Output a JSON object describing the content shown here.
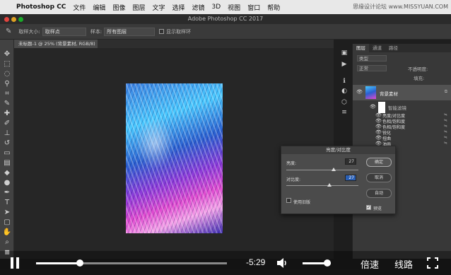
{
  "menubar": {
    "apple_glyph": "",
    "items": [
      "Photoshop CC",
      "文件",
      "编辑",
      "图像",
      "图层",
      "文字",
      "选择",
      "滤镜",
      "3D",
      "视图",
      "窗口",
      "帮助"
    ],
    "watermark": "思缘设计论坛 www.MISSYUAN.COM"
  },
  "window": {
    "title": "Adobe Photoshop CC 2017"
  },
  "options_bar": {
    "sample_size_label": "取样大小:",
    "sample_size_value": "取样点",
    "sample_label": "样本:",
    "sample_value": "所有图层",
    "show_ring_label": "显示取样环"
  },
  "document": {
    "tab_title": "未标题-1 @ 25% (背景素材, RGB/8) *"
  },
  "panel": {
    "tabs": [
      "图层",
      "通道",
      "路径"
    ],
    "filter_kind": "类型",
    "blend_mode": "正常",
    "opacity_label": "不透明度:",
    "fill_label": "填充:",
    "layer_name": "背景素材",
    "smart_filters_label": "智能滤镜",
    "filters": [
      "亮度/对比度",
      "色相/饱和度",
      "色相/饱和度",
      "锐化",
      "扭曲",
      "油画"
    ]
  },
  "dialog": {
    "title": "亮度/对比度",
    "brightness_label": "亮度:",
    "brightness_value": "27",
    "contrast_label": "对比度:",
    "contrast_value": "27",
    "brightness_level": 0.66,
    "contrast_level": 0.6,
    "ok_label": "确定",
    "cancel_label": "取消",
    "auto_label": "自动",
    "legacy_label": "使用旧版",
    "legacy_checked": false,
    "preview_label": "预览",
    "preview_checked": true
  },
  "player": {
    "time_remaining": "-5:29",
    "progress": 0.23,
    "volume": 0.88,
    "speed_label": "倍速",
    "quality_label": "线路"
  },
  "colors": {
    "accent": "#4a90d9",
    "ui_dark": "#383838"
  }
}
